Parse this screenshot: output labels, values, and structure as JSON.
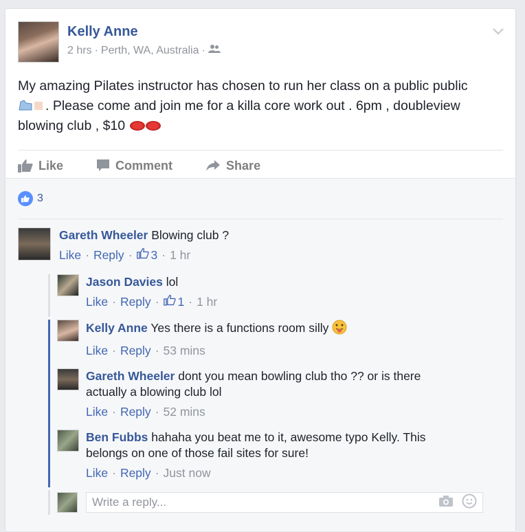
{
  "post": {
    "author": "Kelly Anne",
    "meta_time": "2 hrs",
    "meta_location": "Perth, WA, Australia",
    "dot": "·",
    "text_part1": "My amazing Pilates instructor has chosen to run her class on a public public",
    "text_part2": ". Please come and join me for a killa core work out . 6pm , doubleview blowing club , $10",
    "actions": {
      "like": "Like",
      "comment": "Comment",
      "share": "Share"
    },
    "reaction_count": "3"
  },
  "comments": [
    {
      "name": "Gareth Wheeler",
      "text": "Blowing club ?",
      "like": "Like",
      "reply": "Reply",
      "likes": "3",
      "time": "1 hr"
    }
  ],
  "replies": [
    {
      "name": "Jason Davies",
      "text": "lol",
      "like": "Like",
      "reply": "Reply",
      "likes": "1",
      "time": "1 hr"
    },
    {
      "name": "Kelly Anne",
      "text": "Yes there is a functions room silly",
      "like": "Like",
      "reply": "Reply",
      "time": "53 mins"
    },
    {
      "name": "Gareth Wheeler",
      "text": "dont you mean bowling club tho ?? or is there actually a blowing club lol",
      "like": "Like",
      "reply": "Reply",
      "time": "52 mins"
    },
    {
      "name": "Ben Fubbs",
      "text": "hahaha you beat me to it, awesome typo Kelly. This belongs on one of those fail sites for sure!",
      "like": "Like",
      "reply": "Reply",
      "time": "Just now"
    }
  ],
  "reply_input": {
    "placeholder": "Write a reply..."
  },
  "colors": {
    "link": "#365899",
    "meta": "#90949c",
    "accent": "#4267b2"
  }
}
